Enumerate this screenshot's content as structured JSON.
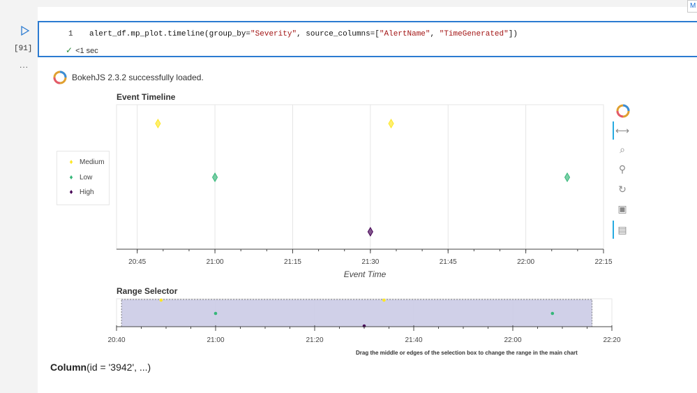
{
  "topbar": {
    "corner_button_label": "M"
  },
  "cell": {
    "run_icon": "play-icon",
    "execution_count": "[91]",
    "more_label": "...",
    "line_number": "1",
    "code_prefix": "alert_df.mp_plot.timeline(group_by=",
    "code_str1": "\"Severity\"",
    "code_mid": ", source_columns=[",
    "code_str2": "\"AlertName\"",
    "code_sep": ", ",
    "code_str3": "\"TimeGenerated\"",
    "code_suffix": "])",
    "status_check": "✓",
    "status_time": "<1 sec"
  },
  "output": {
    "bokeh_loaded": "BokehJS 2.3.2 successfully loaded.",
    "range_hint": "Drag the middle or edges of the selection box to change the range in the main chart",
    "column_name": "Column",
    "column_args": "(id = '3942', ...)"
  },
  "colors": {
    "medium": "#fde725",
    "low": "#35b779",
    "high": "#440154",
    "selection": "#cbcbe6",
    "accent": "#2b7bd1"
  },
  "chart_data": [
    {
      "type": "scatter",
      "title": "Event Timeline",
      "xlabel": "Event Time",
      "ylabel": "",
      "x_ticks": [
        "20:45",
        "21:00",
        "21:15",
        "21:30",
        "21:45",
        "22:00",
        "22:15"
      ],
      "xlim": [
        "20:41",
        "22:15"
      ],
      "legend_placement": "left",
      "grid": true,
      "series": [
        {
          "name": "Medium",
          "color": "#fde725",
          "x": [
            "20:49",
            "21:34"
          ]
        },
        {
          "name": "Low",
          "color": "#35b779",
          "x": [
            "21:00",
            "22:08"
          ]
        },
        {
          "name": "High",
          "color": "#440154",
          "x": [
            "21:30"
          ]
        }
      ]
    },
    {
      "type": "scatter",
      "title": "Range Selector",
      "x_ticks": [
        "20:40",
        "21:00",
        "21:20",
        "21:40",
        "22:00",
        "22:20"
      ],
      "xlim": [
        "20:40",
        "22:20"
      ],
      "selection": [
        "20:41",
        "22:16"
      ],
      "series": [
        {
          "name": "Medium",
          "color": "#fde725",
          "x": [
            "20:49",
            "21:34"
          ]
        },
        {
          "name": "Low",
          "color": "#35b779",
          "x": [
            "21:00",
            "22:08"
          ]
        },
        {
          "name": "High",
          "color": "#440154",
          "x": [
            "21:30"
          ]
        }
      ]
    }
  ],
  "toolbar": {
    "items": [
      {
        "icon": "bokeh-logo-icon"
      },
      {
        "icon": "pan-icon",
        "glyph": "⟷"
      },
      {
        "icon": "box-zoom-icon",
        "glyph": "⌕"
      },
      {
        "icon": "wheel-zoom-icon",
        "glyph": "⚲"
      },
      {
        "icon": "reset-icon",
        "glyph": "↻"
      },
      {
        "icon": "save-icon",
        "glyph": "▣"
      },
      {
        "icon": "hover-icon",
        "glyph": "▤"
      }
    ]
  }
}
